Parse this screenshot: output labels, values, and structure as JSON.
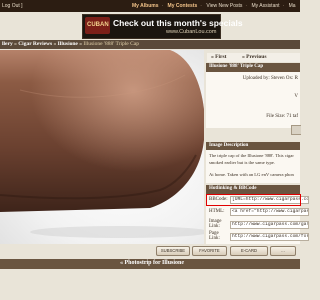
{
  "topbar": {
    "left": "Log Out ]",
    "links": [
      "My Albums",
      "My Contests",
      "View New Posts",
      "My Assistant",
      "Ma"
    ]
  },
  "banner": {
    "logo_text": "CUBAN",
    "headline": "Check out this month's specials",
    "url": "www.CubanLou.com"
  },
  "breadcrumb": {
    "prefix": "llery",
    "cat1": "Cigar Reviews",
    "cat2": "Illusione",
    "current": "Illusione '888' Triple Cap"
  },
  "nav": {
    "first": "« First",
    "prev": "« Previous"
  },
  "info": {
    "title": "Illusione '888' Triple Cap",
    "uploaded": "Uploaded by: Steven Ox: R",
    "views": "V",
    "size": "File Size: 71 taf"
  },
  "description": {
    "title": "Image Description",
    "lines": [
      "The triple cap of the Illusione '888'. This cigar",
      "smoked earlier but is the same type.",
      "",
      "At home. Taken with an LG enV camera phon"
    ]
  },
  "linking": {
    "title": "Hotlinking & BBCode",
    "rows": [
      {
        "label": "BBCode:",
        "value": "[URL=http://www.cigarpass.com"
      },
      {
        "label": "HTML:",
        "value": "<a href=\"http://www.cigarpass.co"
      },
      {
        "label": "Image Link:",
        "value": "http://www.cigarpass.com/gal"
      },
      {
        "label": "Page Link:",
        "value": "http://www.cigarpass.com/for"
      }
    ]
  },
  "actions": [
    "SUBSCRIBE",
    "FAVORITE",
    "E-CARD",
    "..."
  ],
  "photostrip": "« Photostrip for Illusione"
}
